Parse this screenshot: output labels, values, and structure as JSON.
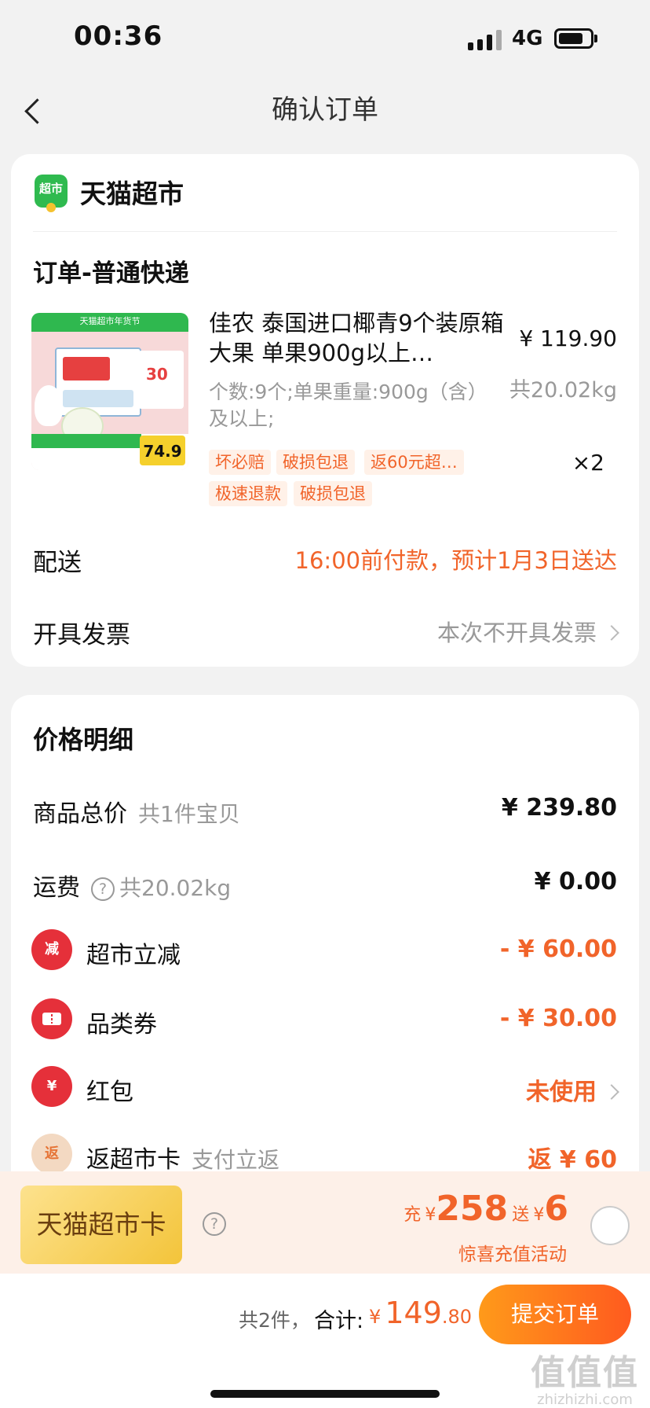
{
  "status_bar": {
    "time": "00:36",
    "network": "4G"
  },
  "nav": {
    "title": "确认订单"
  },
  "store": {
    "logo_text": "超市",
    "name": "天猫超市",
    "order_title": "订单-普通快递"
  },
  "product": {
    "image_banner": "天猫超市年货节",
    "image_price": "74.9",
    "name": "佳农 泰国进口椰青9个装原箱 大果 单果900g以上…",
    "price": "¥ 119.90",
    "spec": "个数:9个;单果重量:900g（含）及以上;",
    "weight": "共20.02kg",
    "qty": "×2",
    "tags": [
      "坏必赔",
      "破损包退",
      "返60元超…",
      "极速退款",
      "破损包退"
    ]
  },
  "delivery": {
    "label": "配送",
    "value": "16:00前付款，预计1月3日送达"
  },
  "invoice": {
    "label": "开具发票",
    "value": "本次不开具发票"
  },
  "price_detail": {
    "title": "价格明细",
    "rows": [
      {
        "label": "商品总价",
        "sub": "共1件宝贝",
        "value": "¥ 239.80"
      },
      {
        "label": "运费",
        "sub": "共20.02kg",
        "value": "¥ 0.00"
      },
      {
        "label": "超市立减",
        "icon": "减",
        "value": "- ¥ 60.00"
      },
      {
        "label": "品类券",
        "value": "- ¥ 30.00"
      },
      {
        "label": "红包",
        "icon": "¥",
        "value": "未使用"
      },
      {
        "label": "返超市卡",
        "icon": "返",
        "sub": "支付立返",
        "value": "返 ¥ 60"
      }
    ]
  },
  "promo": {
    "card_label": "天猫超市卡",
    "charge_prefix": "充",
    "charge_currency": "¥",
    "charge_amount": "258",
    "bonus_prefix": "送",
    "bonus_currency": "¥",
    "bonus_amount": "6",
    "subtitle": "惊喜充值活动"
  },
  "footer": {
    "count": "共2件，",
    "total_label": "合计:",
    "currency": "¥",
    "total_int": "149",
    "total_dec": ".80",
    "submit_label": "提交订单"
  },
  "watermark": {
    "logo": "值值值",
    "text": "zhizhizhi.com"
  },
  "colors": {
    "accent": "#f1642a",
    "brand_green": "#2fba4f",
    "danger": "#e5303a"
  }
}
